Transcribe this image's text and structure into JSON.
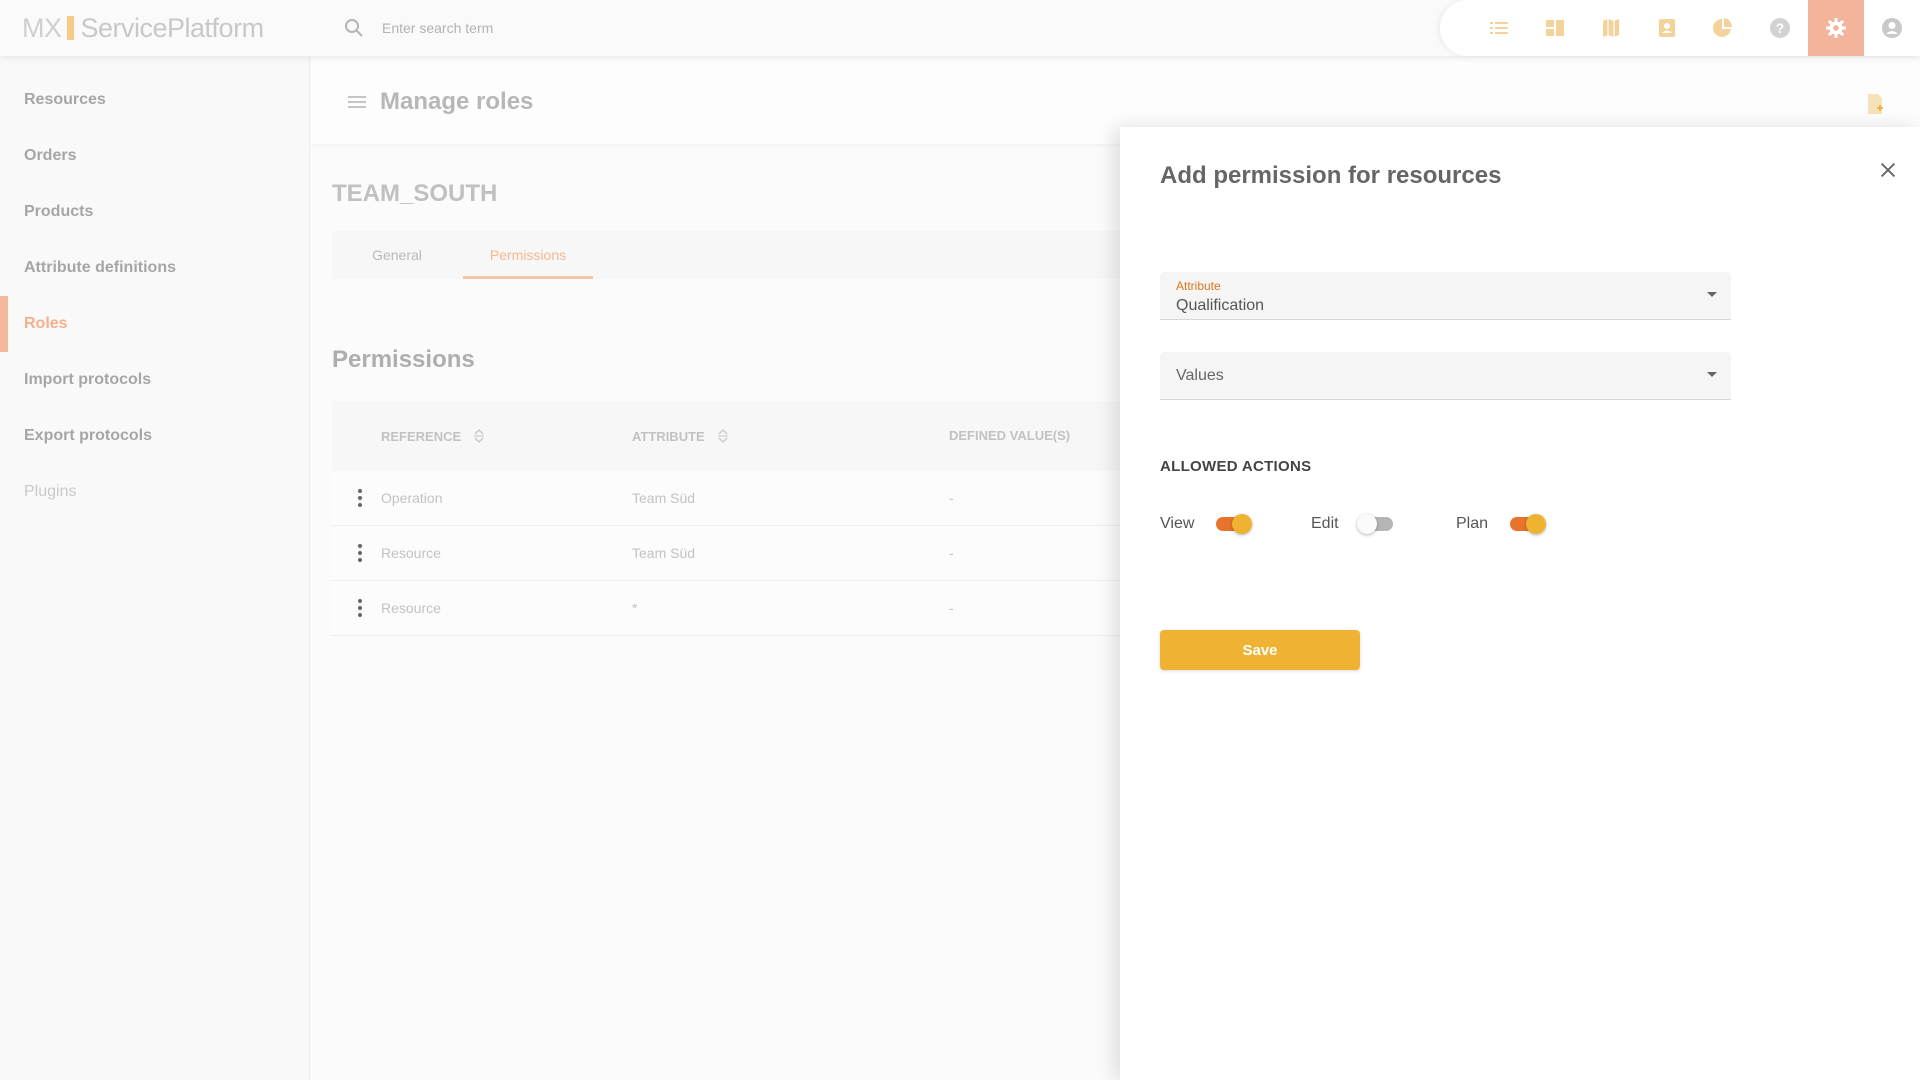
{
  "app": {
    "logo_prefix": "MX",
    "logo_name": "ServicePlatform",
    "search_placeholder": "Enter search term"
  },
  "toolbar": {
    "icons": [
      "list-icon",
      "dashboard-icon",
      "map-icon",
      "contacts-icon",
      "pie-chart-icon",
      "help-icon",
      "settings-icon",
      "account-icon"
    ],
    "active": "settings-icon"
  },
  "sidebar": {
    "items": [
      {
        "label": "Resources"
      },
      {
        "label": "Orders"
      },
      {
        "label": "Products"
      },
      {
        "label": "Attribute definitions"
      },
      {
        "label": "Roles",
        "active": true
      },
      {
        "label": "Import protocols"
      },
      {
        "label": "Export protocols"
      },
      {
        "label": "Plugins",
        "disabled": true
      }
    ]
  },
  "main": {
    "title": "Manage roles",
    "role_name": "TEAM_SOUTH",
    "tabs": [
      {
        "label": "General"
      },
      {
        "label": "Permissions",
        "active": true
      }
    ],
    "section_title": "Permissions",
    "table": {
      "headers": [
        "REFERENCE",
        "ATTRIBUTE",
        "DEFINED VALUE(S)"
      ],
      "rows": [
        {
          "reference": "Operation",
          "attribute": "Team Süd",
          "values": "-"
        },
        {
          "reference": "Resource",
          "attribute": "Team Süd",
          "values": "-"
        },
        {
          "reference": "Resource",
          "attribute": "*",
          "values": "-"
        }
      ]
    }
  },
  "panel": {
    "title": "Add permission for resources",
    "attribute_label": "Attribute",
    "attribute_value": "Qualification",
    "values_placeholder": "Values",
    "allowed_actions_title": "ALLOWED ACTIONS",
    "actions": [
      {
        "label": "View",
        "enabled": true
      },
      {
        "label": "Edit",
        "enabled": false
      },
      {
        "label": "Plan",
        "enabled": true
      }
    ],
    "save_label": "Save"
  },
  "colors": {
    "accent": "#f0b233",
    "toggle_track_on": "#e8742b",
    "active_nav": "#f4b08a",
    "field_label": "#e0761e"
  }
}
